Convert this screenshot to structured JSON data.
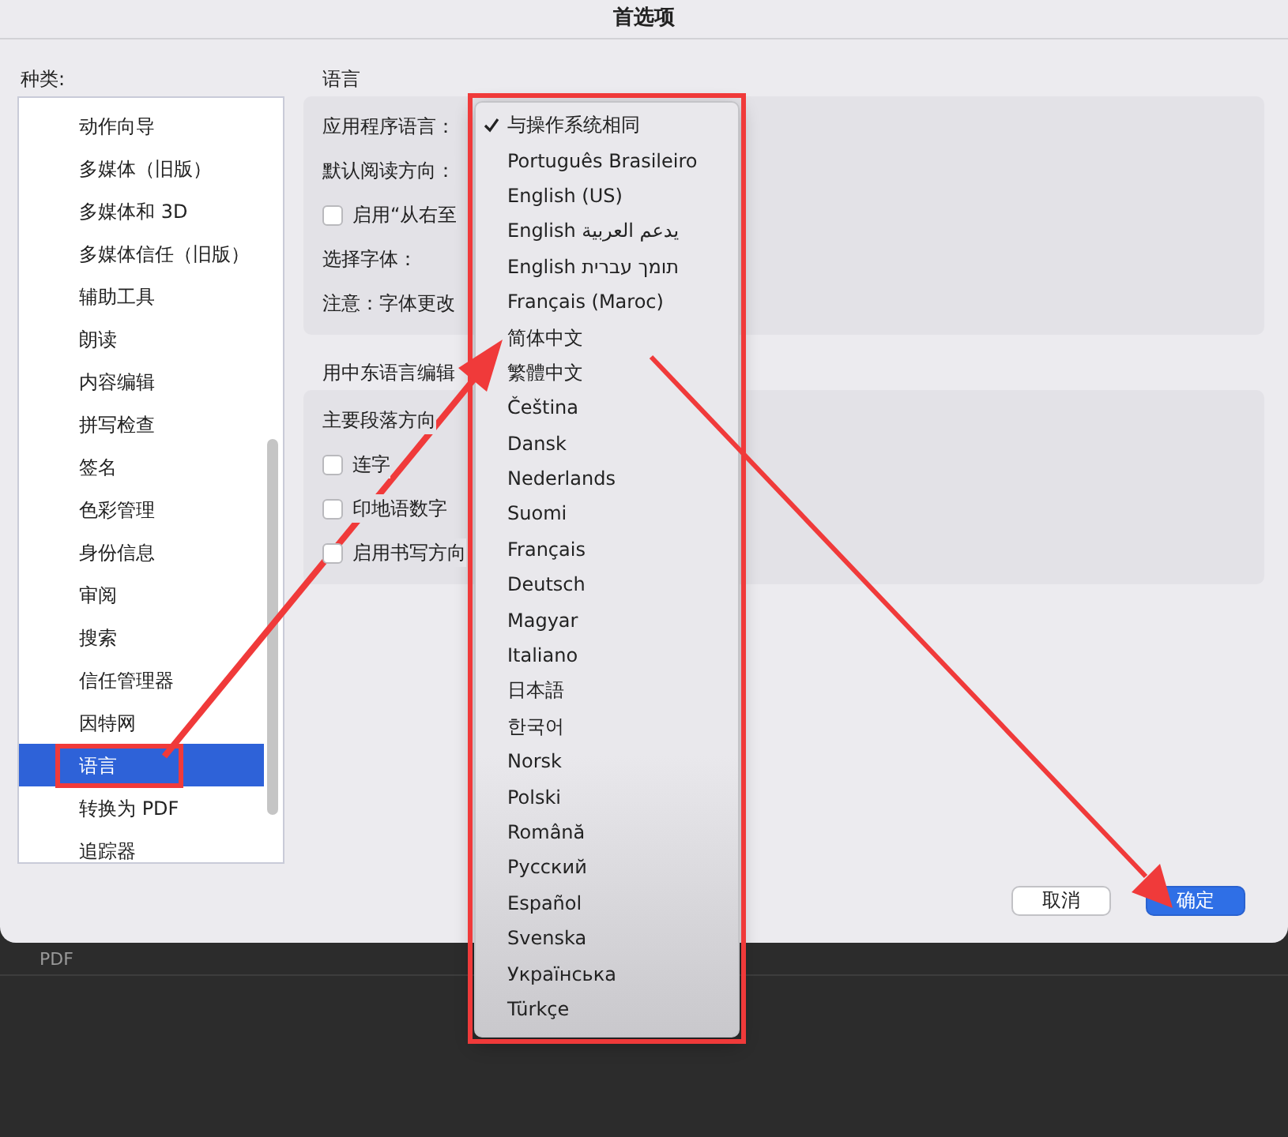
{
  "window": {
    "title": "首选项"
  },
  "sidebar": {
    "label": "种类:",
    "items": [
      {
        "label": "动作向导",
        "selected": false
      },
      {
        "label": "多媒体（旧版）",
        "selected": false
      },
      {
        "label": "多媒体和 3D",
        "selected": false
      },
      {
        "label": "多媒体信任（旧版）",
        "selected": false
      },
      {
        "label": "辅助工具",
        "selected": false
      },
      {
        "label": "朗读",
        "selected": false
      },
      {
        "label": "内容编辑",
        "selected": false
      },
      {
        "label": "拼写检查",
        "selected": false
      },
      {
        "label": "签名",
        "selected": false
      },
      {
        "label": "色彩管理",
        "selected": false
      },
      {
        "label": "身份信息",
        "selected": false
      },
      {
        "label": "审阅",
        "selected": false
      },
      {
        "label": "搜索",
        "selected": false
      },
      {
        "label": "信任管理器",
        "selected": false
      },
      {
        "label": "因特网",
        "selected": false
      },
      {
        "label": "语言",
        "selected": true
      },
      {
        "label": "转换为 PDF",
        "selected": false
      },
      {
        "label": "追踪器",
        "selected": false
      }
    ]
  },
  "sections": [
    {
      "heading": "语言",
      "rows": [
        {
          "kind": "label",
          "text": "应用程序语言："
        },
        {
          "kind": "label",
          "text": "默认阅读方向："
        },
        {
          "kind": "checkbox",
          "label": "启用“从右至",
          "checked": false
        },
        {
          "kind": "label",
          "text": "选择字体："
        },
        {
          "kind": "label",
          "text": "注意：字体更改"
        }
      ]
    },
    {
      "heading": "用中东语言编辑",
      "rows": [
        {
          "kind": "label",
          "text": "主要段落方向"
        },
        {
          "kind": "checkbox",
          "label": "连字",
          "checked": false
        },
        {
          "kind": "checkbox",
          "label": "印地语数字",
          "checked": false
        },
        {
          "kind": "checkbox",
          "label": "启用书写方向",
          "checked": false
        }
      ]
    }
  ],
  "language_menu": {
    "items": [
      {
        "label": "与操作系统相同",
        "selected": true
      },
      {
        "label": "Português Brasileiro",
        "selected": false
      },
      {
        "label": "English (US)",
        "selected": false
      },
      {
        "label": "English يدعم العربية",
        "selected": false
      },
      {
        "label": "English תומך עברית",
        "selected": false
      },
      {
        "label": "Français (Maroc)",
        "selected": false
      },
      {
        "label": "简体中文",
        "selected": false
      },
      {
        "label": "繁體中文",
        "selected": false
      },
      {
        "label": "Čeština",
        "selected": false
      },
      {
        "label": "Dansk",
        "selected": false
      },
      {
        "label": "Nederlands",
        "selected": false
      },
      {
        "label": "Suomi",
        "selected": false
      },
      {
        "label": "Français",
        "selected": false
      },
      {
        "label": "Deutsch",
        "selected": false
      },
      {
        "label": "Magyar",
        "selected": false
      },
      {
        "label": "Italiano",
        "selected": false
      },
      {
        "label": "日本語",
        "selected": false
      },
      {
        "label": "한국어",
        "selected": false
      },
      {
        "label": "Norsk",
        "selected": false
      },
      {
        "label": "Polski",
        "selected": false
      },
      {
        "label": "Română",
        "selected": false
      },
      {
        "label": "Русский",
        "selected": false
      },
      {
        "label": "Español",
        "selected": false
      },
      {
        "label": "Svenska",
        "selected": false
      },
      {
        "label": "Українська",
        "selected": false
      },
      {
        "label": "Türkçe",
        "selected": false
      }
    ]
  },
  "buttons": [
    {
      "label": "取消",
      "kind": "default"
    },
    {
      "label": "确定",
      "kind": "primary"
    }
  ],
  "background": {
    "text": "PDF"
  }
}
